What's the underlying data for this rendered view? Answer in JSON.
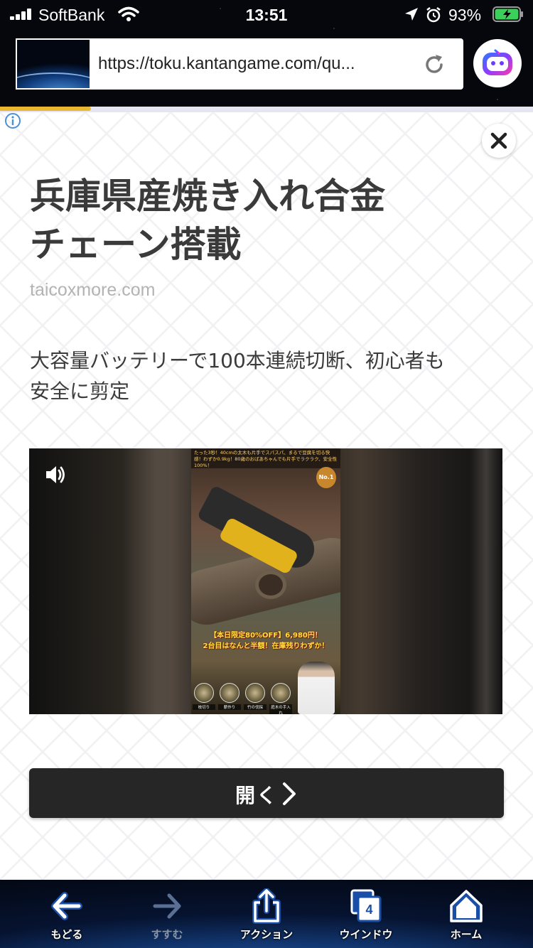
{
  "status_bar": {
    "carrier": "SoftBank",
    "time": "13:51",
    "battery_percent": "93%",
    "signal_bars": 4,
    "charging": true
  },
  "browser": {
    "url": "https://toku.kantangame.com/qu...",
    "page_load_progress": 0.17,
    "icons": {
      "reload": "reload-icon",
      "assistant": "assistant-robot-icon"
    }
  },
  "ad": {
    "headline_line1": "兵庫県産焼き入れ合金",
    "headline_line2": "チェーン搭載",
    "domain": "taicoxmore.com",
    "description_line1": "大容量バッテリーで100本連続切断、初心者も",
    "description_line2": "安全に剪定",
    "video": {
      "caption_top": "たった3秒！40cmの太木も片手でスパスパ、まるで豆腐を切る快感！わずか0.9kg！80歳のおばあちゃんでも片手でラクラク、安全性100%！",
      "badge": "No.1",
      "price_line1": "【本日限定80%OFF】6,980円！",
      "price_line2": "2台目はなんと半額！在庫残りわずか！",
      "thumb_labels": [
        "枝切り",
        "薪作り",
        "竹の伐採",
        "庭木の手入れ"
      ]
    },
    "open_button_label": "開く"
  },
  "toolbar": {
    "items": [
      {
        "label": "もどる",
        "icon": "back-arrow-icon",
        "enabled": true
      },
      {
        "label": "すすむ",
        "icon": "forward-arrow-icon",
        "enabled": false
      },
      {
        "label": "アクション",
        "icon": "share-action-icon",
        "enabled": true
      },
      {
        "label": "ウインドウ",
        "icon": "windows-icon",
        "enabled": true,
        "badge": "4"
      },
      {
        "label": "ホーム",
        "icon": "home-icon",
        "enabled": true
      }
    ]
  },
  "colors": {
    "accent_progress": "#e9b830",
    "button_dark": "#262626",
    "headline_text": "#3a3a3a",
    "domain_text": "#b3b3b3",
    "info_icon": "#4a90d9"
  }
}
